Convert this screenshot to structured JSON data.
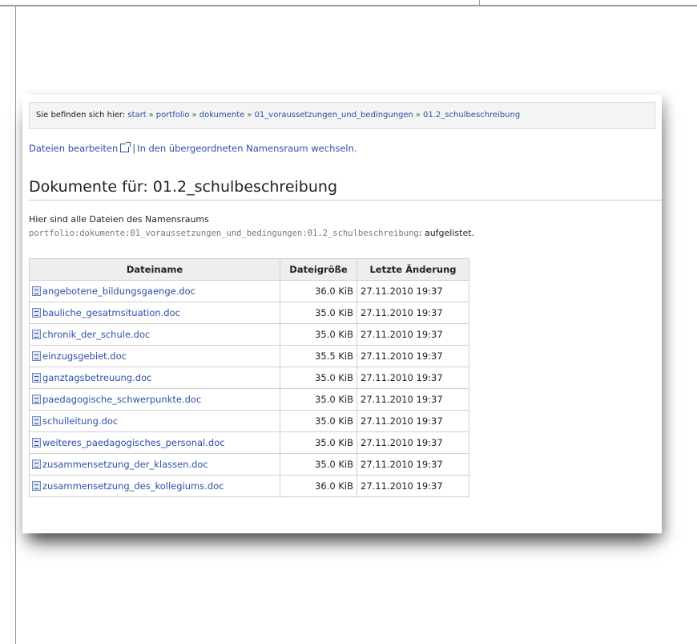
{
  "breadcrumb": {
    "prefix": "Sie befinden sich hier:",
    "items": [
      "start",
      "portfolio",
      "dokumente",
      "01_voraussetzungen_und_bedingungen",
      "01.2_schulbeschreibung"
    ],
    "separator": "»"
  },
  "actions": {
    "edit_label": "Dateien bearbeiten",
    "separator": "|",
    "parent_label": "In den übergeordneten Namensraum wechseln."
  },
  "page": {
    "title": "Dokumente für: 01.2_schulbeschreibung",
    "intro": "Hier sind alle Dateien des Namensraums",
    "namespace": "portfolio:dokumente:01_voraussetzungen_und_bedingungen:01.2_schulbeschreibung",
    "namespace_suffix": ": aufgelistet."
  },
  "table": {
    "headers": [
      "Dateiname",
      "Dateigröße",
      "Letzte Änderung"
    ],
    "rows": [
      {
        "name": "angebotene_bildungsgaenge.doc",
        "size": "36.0 KiB",
        "date": "27.11.2010 19:37"
      },
      {
        "name": "bauliche_gesatmsituation.doc",
        "size": "35.0 KiB",
        "date": "27.11.2010 19:37"
      },
      {
        "name": "chronik_der_schule.doc",
        "size": "35.0 KiB",
        "date": "27.11.2010 19:37"
      },
      {
        "name": "einzugsgebiet.doc",
        "size": "35.5 KiB",
        "date": "27.11.2010 19:37"
      },
      {
        "name": "ganztagsbetreuung.doc",
        "size": "35.0 KiB",
        "date": "27.11.2010 19:37"
      },
      {
        "name": "paedagogische_schwerpunkte.doc",
        "size": "35.0 KiB",
        "date": "27.11.2010 19:37"
      },
      {
        "name": "schulleitung.doc",
        "size": "35.0 KiB",
        "date": "27.11.2010 19:37"
      },
      {
        "name": "weiteres_paedagogisches_personal.doc",
        "size": "35.0 KiB",
        "date": "27.11.2010 19:37"
      },
      {
        "name": "zusammensetzung_der_klassen.doc",
        "size": "35.0 KiB",
        "date": "27.11.2010 19:37"
      },
      {
        "name": "zusammensetzung_des_kollegiums.doc",
        "size": "36.0 KiB",
        "date": "27.11.2010 19:37"
      }
    ]
  },
  "icons": {
    "file": "doc-file-icon",
    "external": "external-link-icon"
  },
  "colors": {
    "link": "#2b52a6",
    "header_bg": "#eeeeee",
    "breadcrumb_bg": "#f4f4f4"
  }
}
